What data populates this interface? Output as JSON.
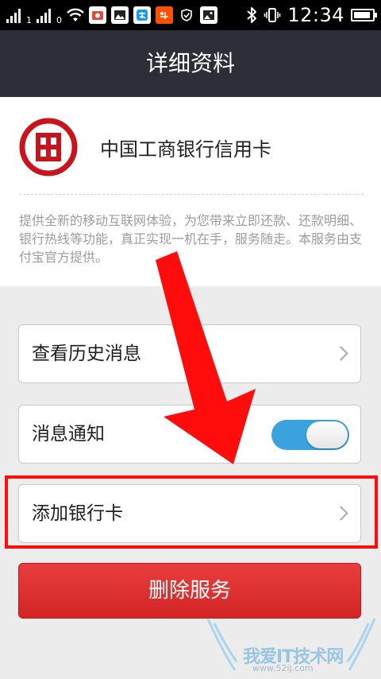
{
  "status_bar": {
    "sim1": "1",
    "sim2": "0",
    "time": "12:34",
    "battery_level": 0.9
  },
  "header": {
    "title": "详细资料"
  },
  "bank": {
    "name": "中国工商银行信用卡",
    "logo_color": "#c8151d"
  },
  "description": "提供全新的移动互联网体验，为您带来立即还款、还款明细、银行热线等功能，真正实现一机在手，服务随走。本服务由支付宝官方提供。",
  "rows": [
    {
      "label": "查看历史消息"
    },
    {
      "label": "消息通知",
      "toggle_on": true
    },
    {
      "label": "添加银行卡"
    }
  ],
  "delete_button": {
    "label": "删除服务"
  },
  "watermark": {
    "text": "我爱IT技术网",
    "url": "www.52ij.com"
  },
  "colors": {
    "header_bg": "#2c2f38",
    "toggle_on": "#3aa2de",
    "delete_bg": "#dc3030",
    "annotation_red": "#ff0d0d"
  }
}
